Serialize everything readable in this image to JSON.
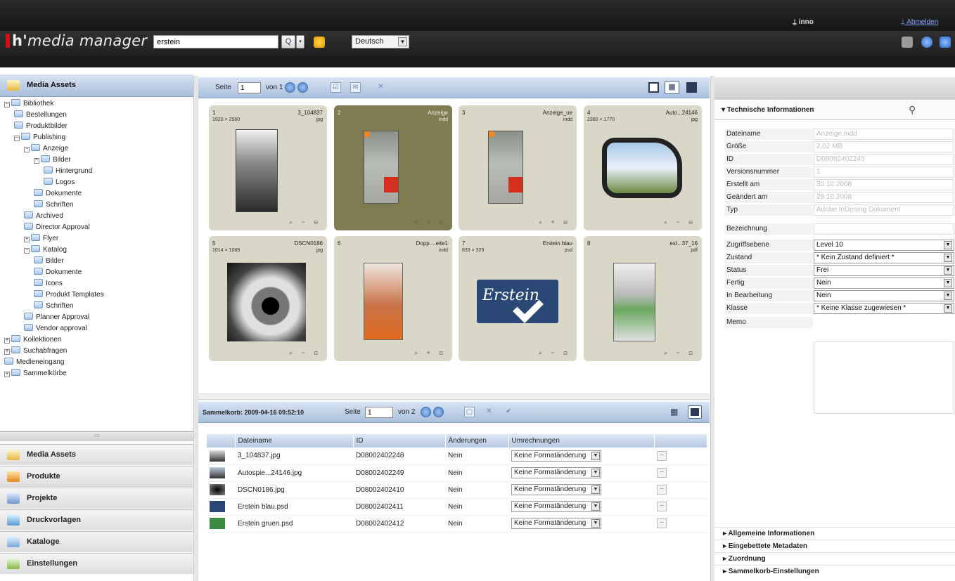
{
  "header": {
    "app_name_brand": "h'",
    "app_name_rest": "media manager",
    "search_value": "erstein",
    "search_button": "Q",
    "language": "Deutsch",
    "user": "inno",
    "logout": "Abmelden"
  },
  "left": {
    "title": "Media Assets",
    "tree": [
      {
        "label": "Bibliothek",
        "indent": 0
      },
      {
        "label": "Bestellungen",
        "indent": 1
      },
      {
        "label": "Produktbilder",
        "indent": 1
      },
      {
        "label": "Publishing",
        "indent": 1
      },
      {
        "label": "Anzeige",
        "indent": 2
      },
      {
        "label": "Bilder",
        "indent": 3
      },
      {
        "label": "Hintergrund",
        "indent": 4
      },
      {
        "label": "Logos",
        "indent": 4
      },
      {
        "label": "Dokumente",
        "indent": 3
      },
      {
        "label": "Schriften",
        "indent": 3
      },
      {
        "label": "Archived",
        "indent": 2
      },
      {
        "label": "Director Approval",
        "indent": 2
      },
      {
        "label": "Flyer",
        "indent": 2
      },
      {
        "label": "Katalog",
        "indent": 2
      },
      {
        "label": "Bilder",
        "indent": 3
      },
      {
        "label": "Dokumente",
        "indent": 3
      },
      {
        "label": "Icons",
        "indent": 3
      },
      {
        "label": "Produkt Templates",
        "indent": 3
      },
      {
        "label": "Schriften",
        "indent": 3
      },
      {
        "label": "Planner Approval",
        "indent": 2
      },
      {
        "label": "Vendor approval",
        "indent": 2
      },
      {
        "label": "Kollektionen",
        "indent": 0
      },
      {
        "label": "Suchabfragen",
        "indent": 0
      },
      {
        "label": "Medieneingang",
        "indent": 0
      },
      {
        "label": "Sammelkörbe",
        "indent": 0
      }
    ],
    "nav": [
      "Media Assets",
      "Produkte",
      "Projekte",
      "Druckvorlagen",
      "Kataloge",
      "Einstellungen"
    ]
  },
  "grid_toolbar": {
    "page_label": "Seite",
    "page_value": "1",
    "of_label": "von 1"
  },
  "tiles": [
    {
      "num": "1",
      "name": "3_104837",
      "dim": "1920 × 2560",
      "ext": "jpg",
      "acts": "⌕ − ⊟",
      "selected": false
    },
    {
      "num": "2",
      "name": "Anzeige",
      "dim": "",
      "ext": "indd",
      "acts": "⌕ + ⊟",
      "selected": true
    },
    {
      "num": "3",
      "name": "Anzeige_ue",
      "dim": "",
      "ext": "indd",
      "acts": "⌕ + ⊟",
      "selected": false
    },
    {
      "num": "4",
      "name": "Auto...24146",
      "dim": "2360 × 1770",
      "ext": "jpg",
      "acts": "⌕ − ⊟",
      "selected": false
    },
    {
      "num": "5",
      "name": "DSCN0186",
      "dim": "1014 × 1089",
      "ext": "jpg",
      "acts": "⌕ − ⊟",
      "selected": false
    },
    {
      "num": "6",
      "name": "Dopp....eite1",
      "dim": "",
      "ext": "indd",
      "acts": "⌕ + ⊟",
      "selected": false
    },
    {
      "num": "7",
      "name": "Erstein blau",
      "dim": "633 × 329",
      "ext": "psd",
      "acts": "⌕ − ⊟",
      "selected": false
    },
    {
      "num": "8",
      "name": "ext...37_16",
      "dim": "",
      "ext": "pdf",
      "acts": "⌕ − ⊟",
      "selected": false
    }
  ],
  "erstein_logo_text": "Erstein",
  "basket": {
    "title": "Sammelkorb: 2009-04-16 09:52:10",
    "page_label": "Seite",
    "page_value": "1",
    "of_label": "von 2",
    "columns": [
      "Dateiname",
      "ID",
      "Änderungen",
      "Umrechnungen"
    ],
    "rows": [
      {
        "file": "3_104837.jpg",
        "id": "D08002402248",
        "changes": "Nein",
        "conv": "Keine Formatänderung"
      },
      {
        "file": "Autospie...24146.jpg",
        "id": "D08002402249",
        "changes": "Nein",
        "conv": "Keine Formatänderung"
      },
      {
        "file": "DSCN0186.jpg",
        "id": "D08002402410",
        "changes": "Nein",
        "conv": "Keine Formatänderung"
      },
      {
        "file": "Erstein blau.psd",
        "id": "D08002402411",
        "changes": "Nein",
        "conv": "Keine Formatänderung"
      },
      {
        "file": "Erstein gruen.psd",
        "id": "D08002402412",
        "changes": "Nein",
        "conv": "Keine Formatänderung"
      }
    ]
  },
  "props": {
    "title": "▾ Technische Informationen",
    "rows": [
      {
        "k": "Dateiname",
        "v": "Anzeige.indd",
        "select": false
      },
      {
        "k": "Größe",
        "v": "2,02 MB",
        "select": false
      },
      {
        "k": "ID",
        "v": "D08002402245",
        "select": false
      },
      {
        "k": "Versionsnummer",
        "v": "1",
        "select": false
      },
      {
        "k": "Erstellt am",
        "v": "30.10.2008",
        "select": false
      },
      {
        "k": "Geändert am",
        "v": "28.10.2008",
        "select": false
      },
      {
        "k": "Typ",
        "v": "Adobe InDesing Dokument",
        "select": false
      },
      {
        "k": "Bezeichnung",
        "v": "",
        "select": false
      },
      {
        "k": "Zugriffsebene",
        "v": "Level 10",
        "select": true
      },
      {
        "k": "Zustand",
        "v": "* Kein Zustand definiert *",
        "select": true
      },
      {
        "k": "Status",
        "v": "Frei",
        "select": true
      },
      {
        "k": "Fertig",
        "v": "Nein",
        "select": true
      },
      {
        "k": "In Bearbeitung",
        "v": "Nein",
        "select": true
      },
      {
        "k": "Klasse",
        "v": "* Keine Klasse zugewiesen *",
        "select": true
      },
      {
        "k": "Memo",
        "v": "",
        "select": false
      }
    ],
    "sections": [
      "▸ Allgemeine Informationen",
      "▸ Eingebettete Metadaten",
      "▸ Zuordnung",
      "▸ Sammelkorb-Einstellungen"
    ]
  },
  "colors": {
    "brand_red": "#d0101c",
    "header_bg": "#1e1e1e",
    "panel_blue": "#a9bfdc",
    "tile_bg": "#d9d8c6",
    "tile_selected": "#7f7c51"
  }
}
